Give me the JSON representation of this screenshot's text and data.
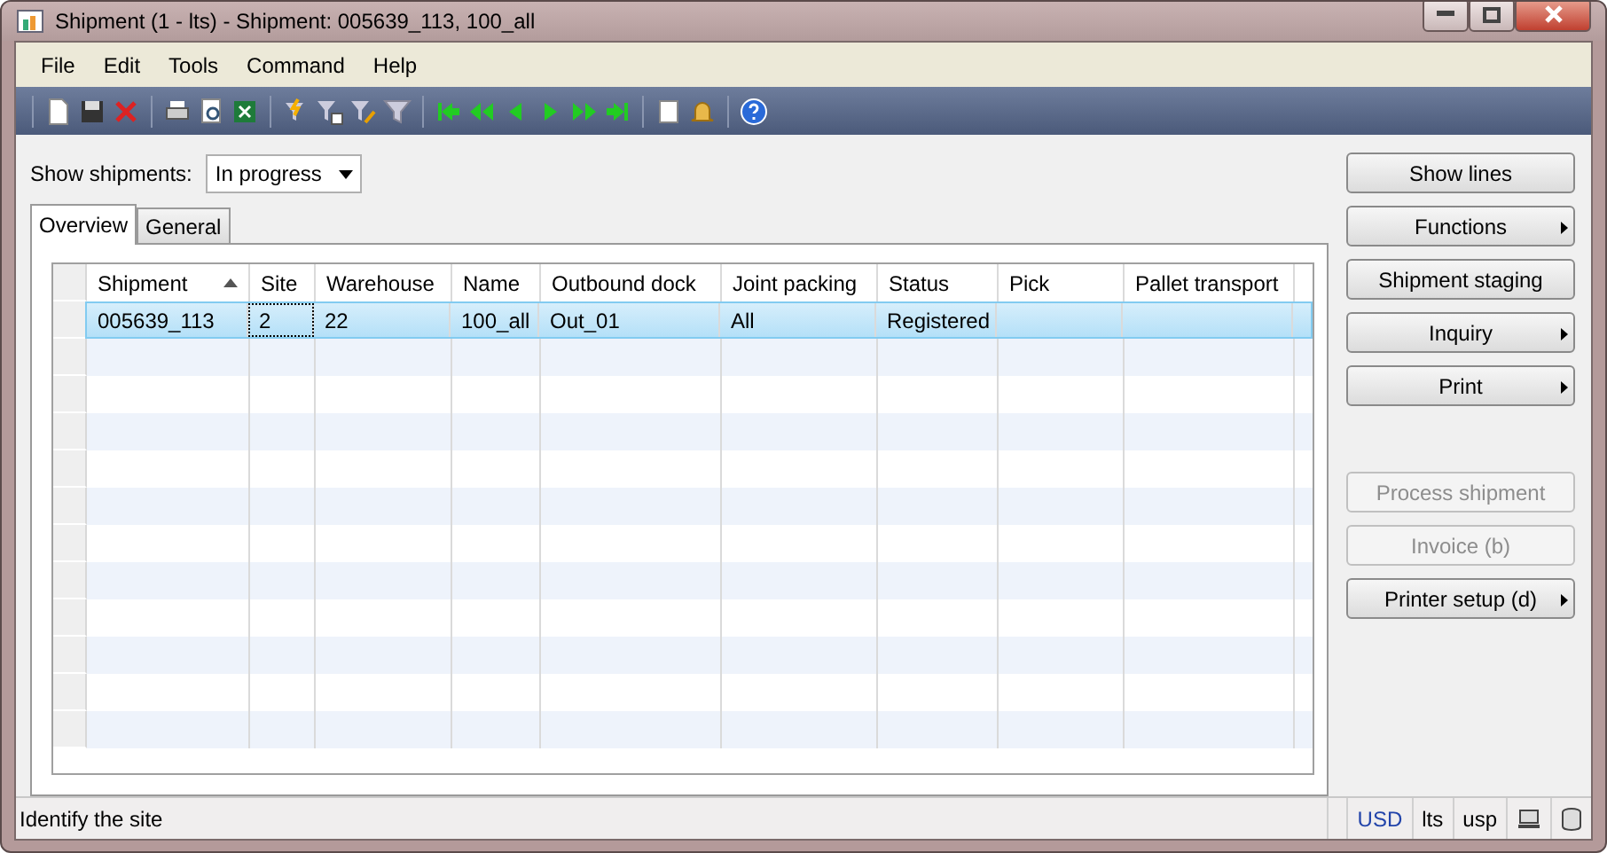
{
  "window": {
    "title": "Shipment (1 - lts) - Shipment: 005639_113, 100_all"
  },
  "menu": [
    "File",
    "Edit",
    "Tools",
    "Command",
    "Help"
  ],
  "filter": {
    "label": "Show shipments:",
    "value": "In progress"
  },
  "tabs": [
    {
      "label": "Overview",
      "selected": true
    },
    {
      "label": "General",
      "selected": false
    }
  ],
  "table": {
    "columns": [
      {
        "label": "Shipment",
        "sorted": true
      },
      {
        "label": "Site",
        "sorted": false
      },
      {
        "label": "Warehouse",
        "sorted": false
      },
      {
        "label": "Name",
        "sorted": false
      },
      {
        "label": "Outbound dock",
        "sorted": false
      },
      {
        "label": "Joint packing",
        "sorted": false
      },
      {
        "label": "Status",
        "sorted": false
      },
      {
        "label": "Pick",
        "sorted": false
      },
      {
        "label": "Pallet transport",
        "sorted": false
      }
    ],
    "rows": [
      {
        "selected": true,
        "cells": [
          "005639_113",
          "2",
          "22",
          "100_all",
          "Out_01",
          "All",
          "Registered",
          "",
          ""
        ]
      }
    ]
  },
  "buttons": [
    {
      "label": "Show lines",
      "menu": false,
      "disabled": false
    },
    {
      "label": "Functions",
      "menu": true,
      "disabled": false
    },
    {
      "label": "Shipment staging",
      "menu": false,
      "disabled": false
    },
    {
      "label": "Inquiry",
      "menu": true,
      "disabled": false
    },
    {
      "label": "Print",
      "menu": true,
      "disabled": false
    }
  ],
  "buttons_lower": [
    {
      "label": "Process shipment",
      "menu": false,
      "disabled": true
    },
    {
      "label": "Invoice (b)",
      "menu": false,
      "disabled": true
    },
    {
      "label": "Printer setup (d)",
      "menu": true,
      "disabled": false
    }
  ],
  "status_bar": {
    "message": "Identify the site",
    "fields": [
      "USD",
      "lts",
      "usp"
    ]
  }
}
